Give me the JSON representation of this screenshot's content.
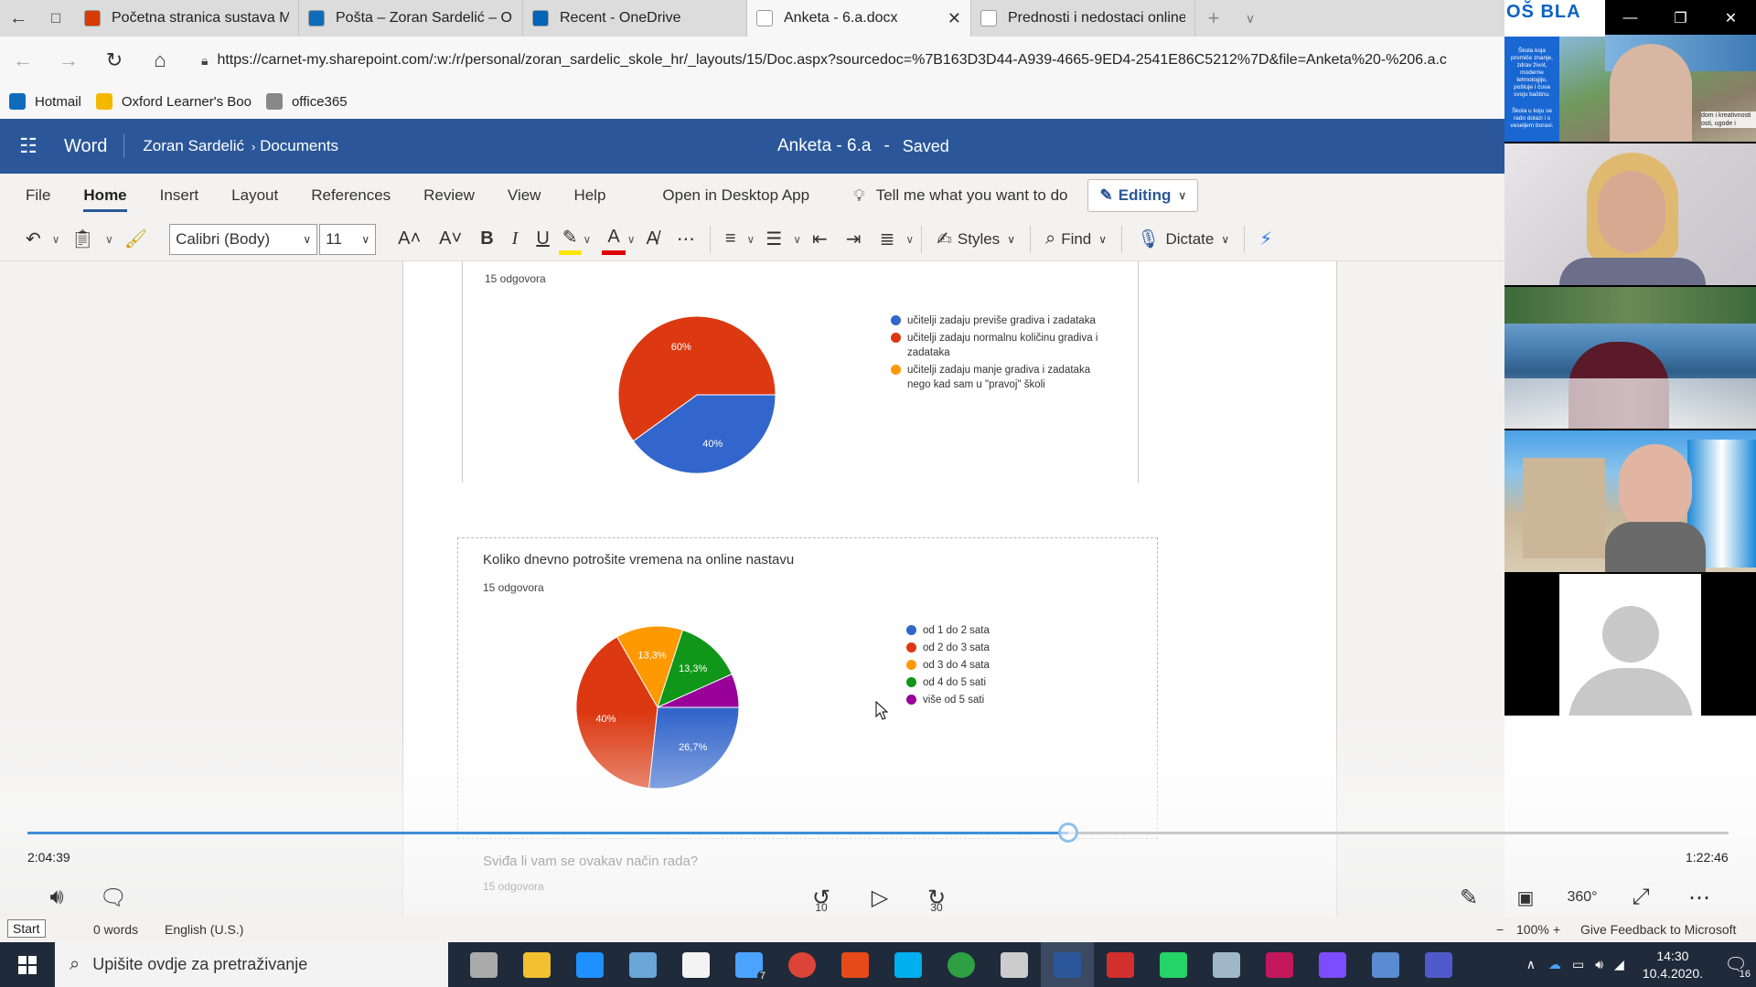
{
  "browser": {
    "tabs": [
      {
        "label": "Početna stranica sustava Mi",
        "color": "#d83b01",
        "active": false
      },
      {
        "label": "Pošta – Zoran Sardelić – Ou",
        "color": "#0f6cbd",
        "active": false
      },
      {
        "label": "Recent - OneDrive",
        "color": "#0364b8",
        "active": false
      },
      {
        "label": "Anketa - 6.a.docx",
        "color": "#ffffff",
        "active": true
      },
      {
        "label": "Prednosti i nedostaci online",
        "color": "#ffffff",
        "active": false
      }
    ],
    "url": "https://carnet-my.sharepoint.com/:w:/r/personal/zoran_sardelic_skole_hr/_layouts/15/Doc.aspx?sourcedoc=%7B163D3D44-A939-4665-9ED4-2541E86C5212%7D&file=Anketa%20-%206.a.c",
    "favorites": [
      {
        "label": "Hotmail",
        "color": "#0f6cbd"
      },
      {
        "label": "Oxford Learner's Boo",
        "color": "#f5b800"
      },
      {
        "label": "office365",
        "color": "#888888"
      }
    ]
  },
  "word": {
    "app": "Word",
    "user": "Zoran Sardelić",
    "crumb": "Documents",
    "doc_title": "Anketa - 6.a",
    "separator": "-",
    "saved": "Saved",
    "ribbon_tabs": [
      "File",
      "Home",
      "Insert",
      "Layout",
      "References",
      "Review",
      "View",
      "Help",
      "Open in Desktop App"
    ],
    "active_tab": "Home",
    "tell_me": "Tell me what you want to do",
    "editing": "Editing",
    "font": "Calibri (Body)",
    "font_size": "11",
    "styles": "Styles",
    "find": "Find",
    "dictate": "Dictate",
    "brand_color": "#2b579a"
  },
  "document": {
    "q1": {
      "responses": "15 odgovora",
      "legend": [
        {
          "label": "učitelji zadaju previše gradiva i zadataka",
          "color": "#3366cc"
        },
        {
          "label": "učitelji zadaju normalnu količinu gradiva i zadataka",
          "color": "#dc3912"
        },
        {
          "label": "učitelji zadaju manje gradiva i zadataka nego kad sam u \"pravoj\" školi",
          "color": "#ff9900"
        }
      ]
    },
    "q2": {
      "title": "Koliko dnevno potrošite vremena na online nastavu",
      "responses": "15 odgovora",
      "legend": [
        {
          "label": "od 1 do 2 sata",
          "color": "#3366cc"
        },
        {
          "label": "od 2 do 3 sata",
          "color": "#dc3912"
        },
        {
          "label": "od 3 do 4 sata",
          "color": "#ff9900"
        },
        {
          "label": "od 4 do 5 sati",
          "color": "#109618"
        },
        {
          "label": "više od 5 sati",
          "color": "#990099"
        }
      ]
    },
    "q3": {
      "title": "Sviđa li vam se ovakav način rada?",
      "responses": "15 odgovora"
    }
  },
  "chart_data": [
    {
      "type": "pie",
      "categories": [
        "učitelji zadaju previše gradiva i zadataka",
        "učitelji zadaju normalnu količinu gradiva i zadataka",
        "učitelji zadaju manje gradiva i zadataka nego kad sam u \"pravoj\" školi"
      ],
      "values": [
        40,
        60,
        0
      ],
      "value_labels": [
        "40%",
        "60%",
        ""
      ],
      "colors": [
        "#3366cc",
        "#dc3912",
        "#ff9900"
      ],
      "legend": "right"
    },
    {
      "type": "pie",
      "categories": [
        "od 1 do 2 sata",
        "od 2 do 3 sata",
        "od 3 do 4 sata",
        "od 4 do 5 sati",
        "više od 5 sati"
      ],
      "values": [
        26.7,
        40,
        13.3,
        13.3,
        6.7
      ],
      "value_labels": [
        "26,7%",
        "40%",
        "13,3%",
        "13,3%",
        ""
      ],
      "colors": [
        "#3366cc",
        "#dc3912",
        "#ff9900",
        "#109618",
        "#990099"
      ],
      "legend": "right"
    }
  ],
  "video": {
    "elapsed": "2:04:39",
    "remaining": "1:22:46",
    "progress": 0.612,
    "rewind": "10",
    "forward": "30",
    "accent": "#3d8ed6"
  },
  "status": {
    "start": "Start",
    "words": "0 words",
    "language": "English (U.S.)",
    "zoom": "100%",
    "feedback": "Give Feedback to Microsoft"
  },
  "participants": {
    "school_lines": [
      "OŠ BLA",
      "Škola koja promiče znanje, zdrav život, moderne tehnologije, poštuje i čuva svoju baštinu.",
      "Škola u koju se rado dolazi i s veseljem boravi.",
      "dom i kreativnosti osti, ugode i"
    ]
  },
  "taskbar": {
    "search_placeholder": "Upišite ovdje za pretraživanje",
    "time": "14:30",
    "date": "10.4.2020.",
    "mail_badge": "7",
    "notif_badge": "16"
  }
}
